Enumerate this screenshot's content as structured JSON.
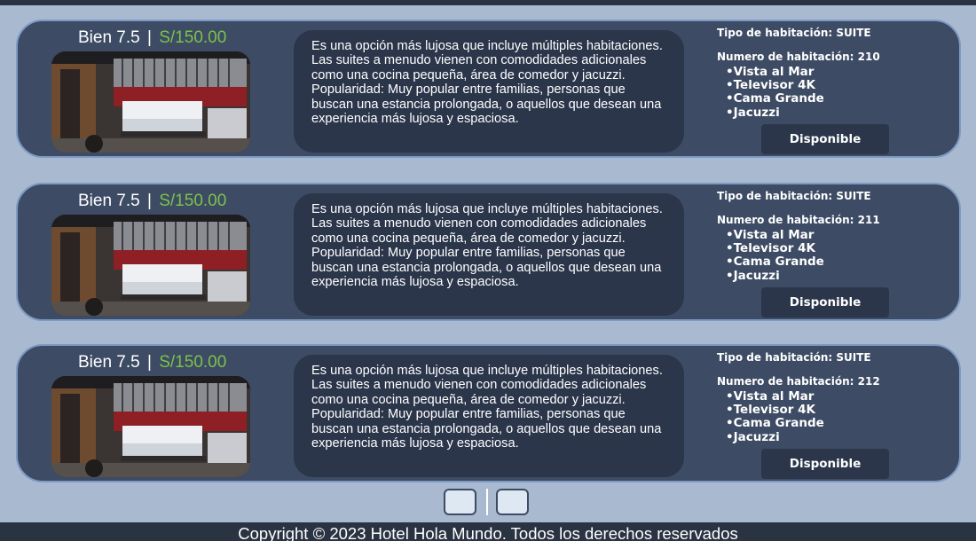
{
  "rooms": [
    {
      "rating_text": "Bien 7.5",
      "separator": "|",
      "price": "S/150.00",
      "description": "Es una opción más lujosa que incluye múltiples habitaciones. Las suites a menudo vienen con comodidades adicionales como una cocina pequeña, área de comedor y jacuzzi. Popularidad: Muy popular entre familias, personas que buscan una estancia prolongada, o aquellos que desean una experiencia más lujosa y espaciosa.",
      "room_type": "Tipo de habitación: SUITE",
      "room_number": "Numero de habitación: 210",
      "features": [
        "Vista al Mar",
        "Televisor 4K",
        "Cama Grande",
        "Jacuzzi"
      ],
      "status_button": "Disponible"
    },
    {
      "rating_text": "Bien 7.5",
      "separator": "|",
      "price": "S/150.00",
      "description": "Es una opción más lujosa que incluye múltiples habitaciones. Las suites a menudo vienen con comodidades adicionales como una cocina pequeña, área de comedor y jacuzzi. Popularidad: Muy popular entre familias, personas que buscan una estancia prolongada, o aquellos que desean una experiencia más lujosa y espaciosa.",
      "room_type": "Tipo de habitación: SUITE",
      "room_number": "Numero de habitación: 211",
      "features": [
        "Vista al Mar",
        "Televisor 4K",
        "Cama Grande",
        "Jacuzzi"
      ],
      "status_button": "Disponible"
    },
    {
      "rating_text": "Bien 7.5",
      "separator": "|",
      "price": "S/150.00",
      "description": "Es una opción más lujosa que incluye múltiples habitaciones. Las suites a menudo vienen con comodidades adicionales como una cocina pequeña, área de comedor y jacuzzi. Popularidad: Muy popular entre familias, personas que buscan una estancia prolongada, o aquellos que desean una experiencia más lujosa y espaciosa.",
      "room_type": "Tipo de habitación: SUITE",
      "room_number": "Numero de habitación: 212",
      "features": [
        "Vista al Mar",
        "Televisor 4K",
        "Cama Grande",
        "Jacuzzi"
      ],
      "status_button": "Disponible"
    }
  ],
  "footer": {
    "copyright": "Copyright © 2023 Hotel Hola Mundo. Todos los derechos reservados"
  },
  "colors": {
    "page_background": "#a9b9cf",
    "card_background": "#3d4b64",
    "card_border": "#7c9ac4",
    "panel_dark": "#2b364b",
    "price_green": "#7cc24a",
    "footer_background": "#2a3342"
  }
}
